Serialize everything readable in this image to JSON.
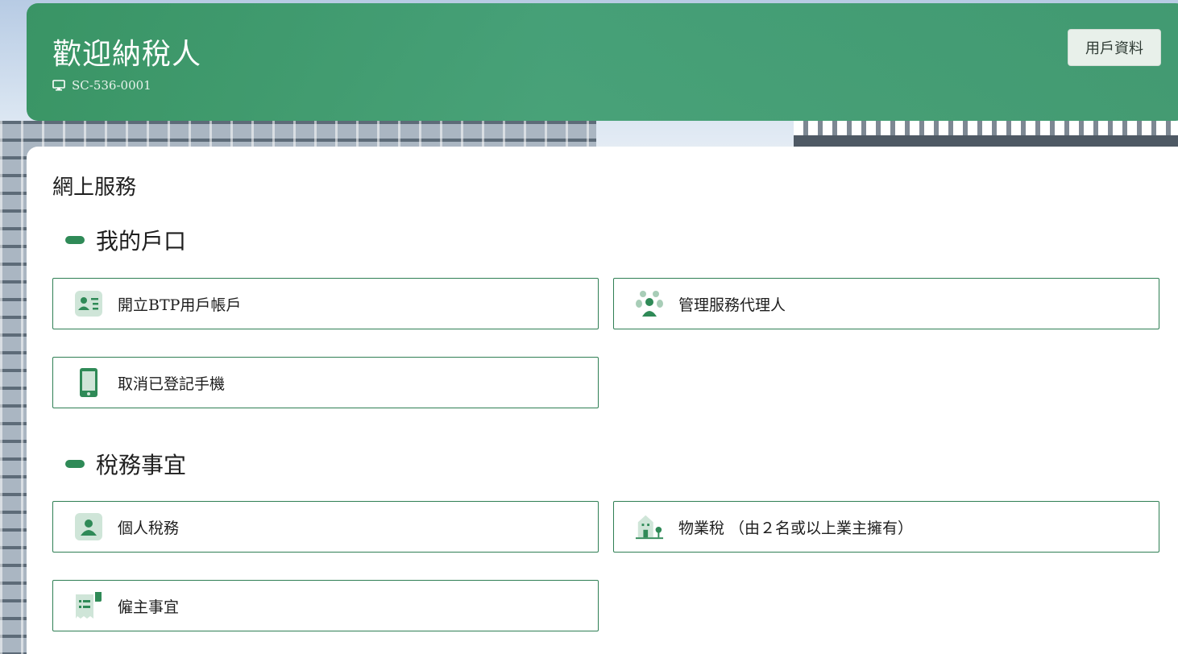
{
  "header": {
    "title": "歡迎納稅人",
    "account_id": "SC-536-0001",
    "profile_button": "用戶資料"
  },
  "main": {
    "section_title": "網上服務",
    "groups": [
      {
        "title": "我的戶口",
        "items": [
          {
            "label": "開立BTP用戶帳戶",
            "icon": "id-card-icon"
          },
          {
            "label": "管理服務代理人",
            "icon": "agents-icon"
          },
          {
            "label": "取消已登記手機",
            "icon": "mobile-phone-icon"
          }
        ]
      },
      {
        "title": "稅務事宜",
        "items": [
          {
            "label": "個人稅務",
            "icon": "person-icon"
          },
          {
            "label": "物業稅 （由２名或以上業主擁有）",
            "icon": "property-icon"
          },
          {
            "label": "僱主事宜",
            "icon": "employer-receipt-icon"
          }
        ]
      }
    ]
  },
  "colors": {
    "brand_green": "#2f8a57",
    "card_border": "#2f7f54",
    "icon_light": "#cfe5d8"
  }
}
